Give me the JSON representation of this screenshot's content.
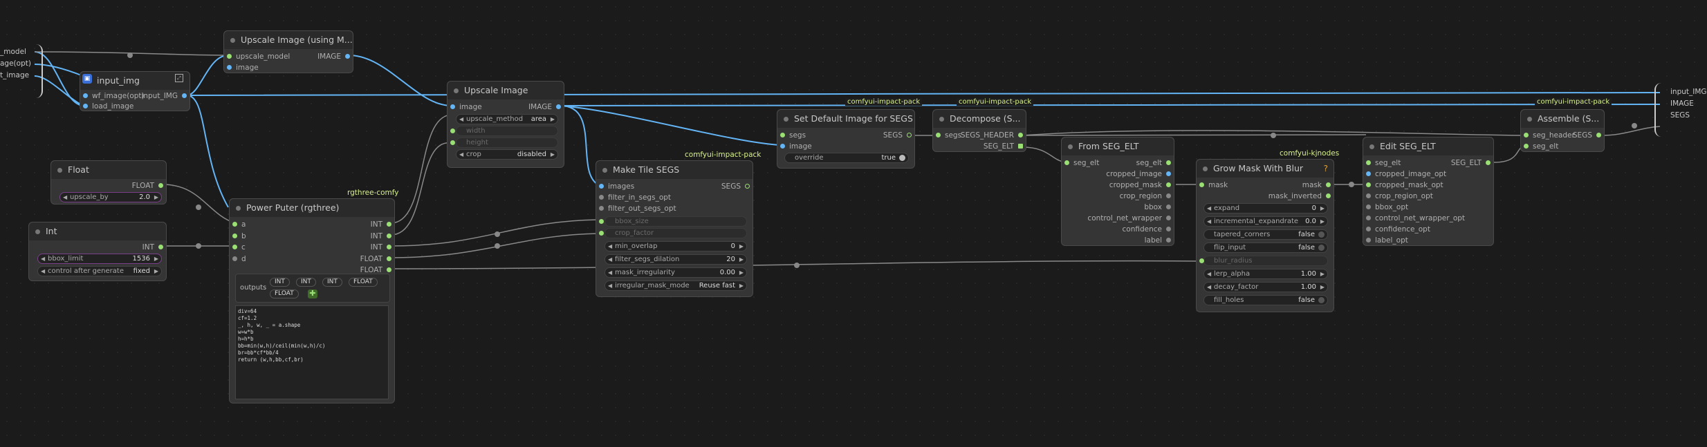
{
  "left_edge_labels": [
    "_model",
    "age(opt)",
    "t_image"
  ],
  "right_edge_labels": [
    "input_IMG",
    "IMAGE",
    "SEGS"
  ],
  "nodes": {
    "input_img": {
      "title": "input_img",
      "inputs": [
        "wf_image(opt)",
        "load_image"
      ],
      "outputs": [
        "input_IMG"
      ]
    },
    "upscale_using": {
      "title": "Upscale Image (using M...",
      "inputs": [
        "upscale_model",
        "image"
      ],
      "outputs": [
        "IMAGE"
      ]
    },
    "upscale_image": {
      "title": "Upscale Image",
      "inputs": [
        "image"
      ],
      "outputs": [
        "IMAGE"
      ],
      "widgets": [
        {
          "label": "upscale_method",
          "value": "area"
        },
        {
          "label": "width",
          "value": ""
        },
        {
          "label": "height",
          "value": ""
        },
        {
          "label": "crop",
          "value": "disabled"
        }
      ]
    },
    "float": {
      "title": "Float",
      "outputs": [
        "FLOAT"
      ],
      "widgets": [
        {
          "label": "upscale_by",
          "value": "2.0"
        }
      ]
    },
    "int": {
      "title": "Int",
      "outputs": [
        "INT"
      ],
      "widgets": [
        {
          "label": "bbox_limit",
          "value": "1536"
        },
        {
          "label": "control after generate",
          "value": "fixed"
        }
      ]
    },
    "power_puter": {
      "title": "Power Puter (rgthree)",
      "badge": "rgthree-comfy",
      "inputs": [
        "a",
        "b",
        "c",
        "d"
      ],
      "outputs": [
        "INT",
        "INT",
        "INT",
        "FLOAT",
        "FLOAT"
      ],
      "outputs_label": "outputs",
      "output_buttons": [
        "INT",
        "INT",
        "INT",
        "FLOAT",
        "FLOAT"
      ],
      "code": "div=64\ncf=1.2\n_, h, w, _ = a.shape\nw=w*b\nh=h*b\nbb=min(w,h)/ceil(min(w,h)/c)\nbr=bb*cf*bb/4\nreturn (w,h,bb,cf,br)"
    },
    "make_tile": {
      "title": "Make Tile SEGS",
      "badge": "comfyui-impact-pack",
      "inputs": [
        "images",
        "filter_in_segs_opt",
        "filter_out_segs_opt"
      ],
      "outputs": [
        "SEGS"
      ],
      "widgets": [
        {
          "label": "bbox_size",
          "value": ""
        },
        {
          "label": "crop_factor",
          "value": ""
        },
        {
          "label": "min_overlap",
          "value": "0"
        },
        {
          "label": "filter_segs_dilation",
          "value": "20"
        },
        {
          "label": "mask_irregularity",
          "value": "0.00"
        },
        {
          "label": "irregular_mask_mode",
          "value": "Reuse fast"
        }
      ]
    },
    "set_default": {
      "title": "Set Default Image for SEGS",
      "inputs": [
        "segs",
        "image"
      ],
      "outputs": [
        "SEGS"
      ],
      "widgets": [
        {
          "label": "override",
          "value": "true"
        }
      ]
    },
    "decompose": {
      "title": "Decompose (S...",
      "badge": "comfyui-impact-pack",
      "inputs": [
        "segs"
      ],
      "outputs": [
        "SEGS_HEADER",
        "SEG_ELT"
      ]
    },
    "from_seg_elt": {
      "title": "From SEG_ELT",
      "badge": "comfyui-impact-pack",
      "inputs": [
        "seg_elt"
      ],
      "outputs": [
        "seg_elt",
        "cropped_image",
        "cropped_mask",
        "crop_region",
        "bbox",
        "control_net_wrapper",
        "confidence",
        "label"
      ]
    },
    "grow_mask": {
      "title": "Grow Mask With Blur",
      "badge": "comfyui-kjnodes",
      "inputs": [
        "mask"
      ],
      "outputs": [
        "mask",
        "mask_inverted"
      ],
      "widgets": [
        {
          "label": "expand",
          "value": "0"
        },
        {
          "label": "incremental_expandrate",
          "value": "0.0"
        },
        {
          "label": "tapered_corners",
          "value": "false"
        },
        {
          "label": "flip_input",
          "value": "false"
        },
        {
          "label": "blur_radius",
          "value": ""
        },
        {
          "label": "lerp_alpha",
          "value": "1.00"
        },
        {
          "label": "decay_factor",
          "value": "1.00"
        },
        {
          "label": "fill_holes",
          "value": "false"
        }
      ]
    },
    "edit_seg_elt": {
      "title": "Edit SEG_ELT",
      "badge": "comfyui-impact-pack",
      "inputs": [
        "seg_elt",
        "cropped_image_opt",
        "cropped_mask_opt",
        "crop_region_opt",
        "bbox_opt",
        "control_net_wrapper_opt",
        "confidence_opt",
        "label_opt"
      ],
      "outputs": [
        "SEG_ELT"
      ]
    },
    "assemble": {
      "title": "Assemble (S...",
      "badge": "comfyui-impact-pack",
      "inputs": [
        "seg_header",
        "seg_elt"
      ],
      "outputs": [
        "SEGS"
      ]
    }
  },
  "wire_labels": {
    "top1": "comfyui-impact-pack",
    "top2": "comfyui-impact-pack",
    "top3": "comfyui-impact-pack"
  },
  "colors": {
    "image_wire": "#64b5f6",
    "generic_wire": "#8a8a8a",
    "badge_text": "#d7f28a",
    "canvas": "#1b1b1b"
  }
}
